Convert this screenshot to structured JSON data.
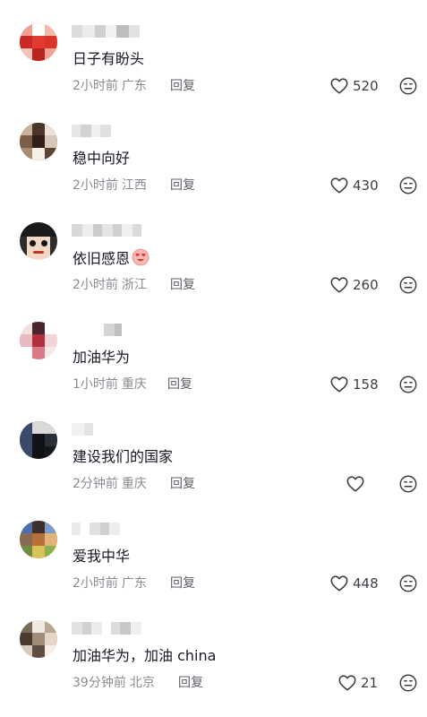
{
  "comments": [
    {
      "text": "日子有盼头",
      "time": "2小时前",
      "location": "广东",
      "reply": "回复",
      "likes": "520",
      "avatar_colors": [
        "#e23b2f",
        "#f2a08f",
        "#c92a25",
        "#ffffff"
      ]
    },
    {
      "text": "稳中向好",
      "time": "2小时前",
      "location": "江西",
      "reply": "回复",
      "likes": "430",
      "avatar_colors": [
        "#4b3527",
        "#c9b39c",
        "#7a5e48",
        "#e9e1d8"
      ]
    },
    {
      "text": "依旧感恩",
      "time": "2小时前",
      "location": "浙江",
      "reply": "回复",
      "likes": "260",
      "avatar_colors": [
        "#1a1a1a",
        "#f3d8c5",
        "#2c2c2c",
        "#ffffff"
      ]
    },
    {
      "text": "加油华为",
      "time": "1小时前",
      "location": "重庆",
      "reply": "回复",
      "likes": "158",
      "avatar_colors": [
        "#f2dfe2",
        "#b3313f",
        "#e9b9c0",
        "#ffffff"
      ]
    },
    {
      "text": "建设我们的国家",
      "time": "2分钟前",
      "location": "重庆",
      "reply": "回复",
      "likes": "",
      "avatar_colors": [
        "#101216",
        "#3a4a6b",
        "#1f232b",
        "#d9d9d9"
      ]
    },
    {
      "text": "爱我中华",
      "time": "2小时前",
      "location": "广东",
      "reply": "回复",
      "likes": "448",
      "avatar_colors": [
        "#3d2f2a",
        "#c98d4a",
        "#6c8e3d",
        "#4a6fb0"
      ]
    },
    {
      "text": "加油华为，加油 china",
      "time": "39分钟前",
      "location": "北京",
      "reply": "回复",
      "likes": "21",
      "avatar_colors": [
        "#7a6a5a",
        "#c9b8a5",
        "#f0e9e2",
        "#4a3b30"
      ]
    }
  ],
  "icons": {
    "like": "heart-outline-icon",
    "dislike": "neutral-face-icon",
    "emoji": "smiling-face-with-heart-eyes"
  },
  "colors": {
    "text": "#161823",
    "meta": "#8a8b91",
    "reply": "#5e6068",
    "icon": "#3d3e44"
  }
}
